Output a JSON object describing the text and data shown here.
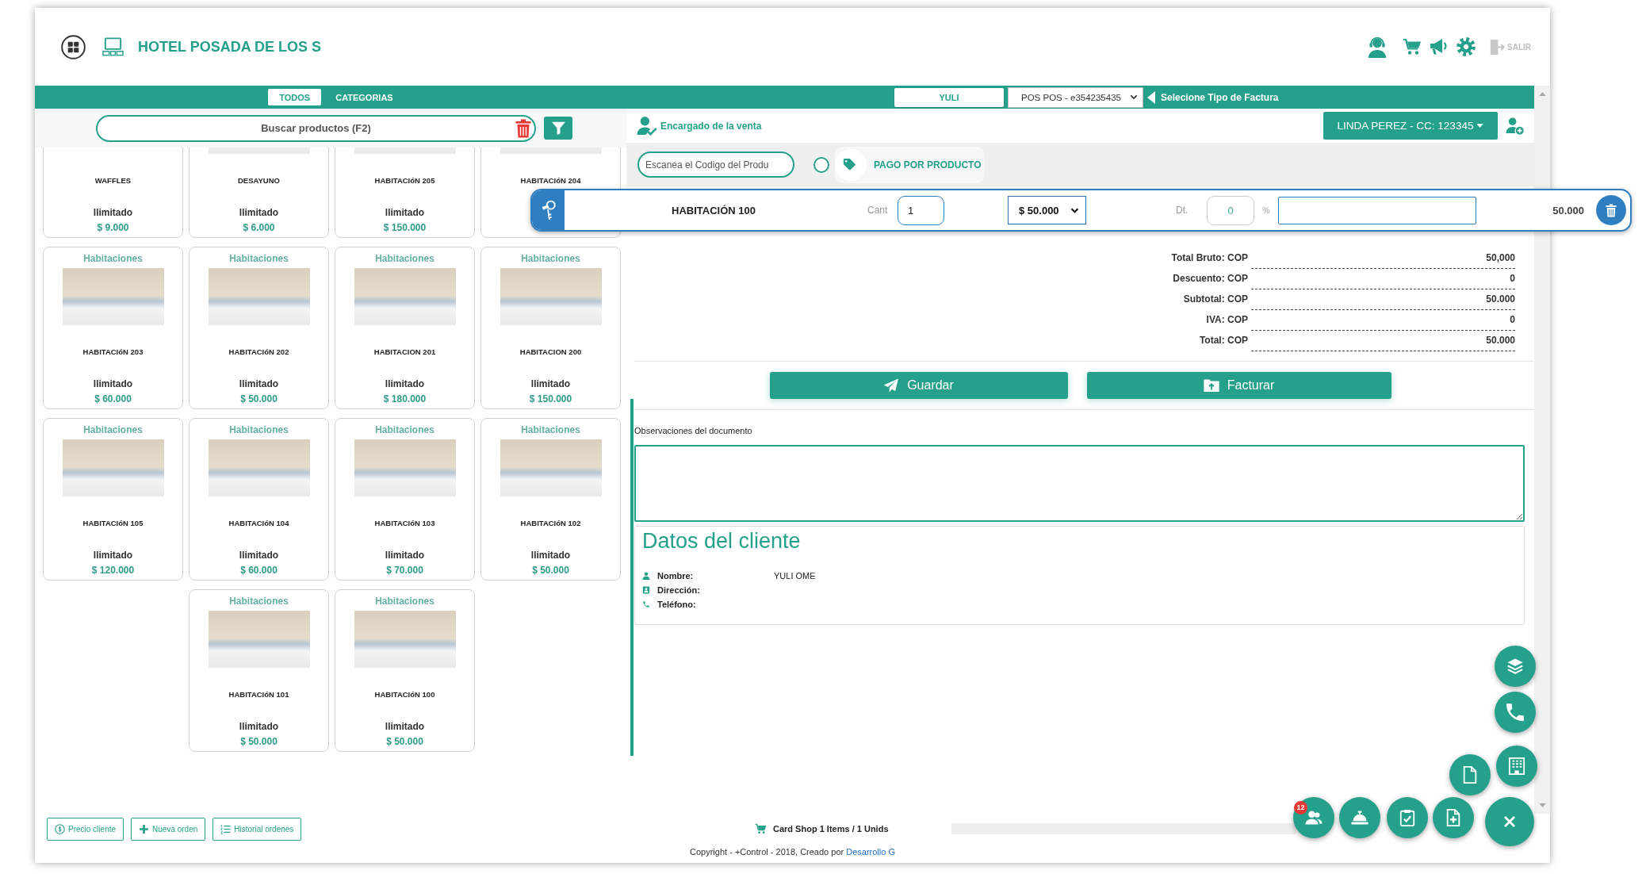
{
  "header": {
    "title": "HOTEL POSADA DE LOS S",
    "logout": "SALIR"
  },
  "toolbar": {
    "tabs": [
      {
        "label": "TODOS",
        "selected": true
      },
      {
        "label": "CATEGORIAS",
        "selected": false
      }
    ],
    "seller": "YULI",
    "pos": "POS POS - e354235435",
    "invoice_hint": "Selecione Tipo de Factura"
  },
  "search": {
    "placeholder": "Buscar productos (F2)"
  },
  "products": [
    {
      "name": "WAFFLES",
      "photo": false,
      "stock": "Ilimitado",
      "price": "$ 9.000"
    },
    {
      "name": "DESAYUNO",
      "photo": true,
      "stock": "Ilimitado",
      "price": "$ 6.000"
    },
    {
      "name": "HABITACIóN 205",
      "photo": true,
      "stock": "Ilimitado",
      "price": "$ 150.000"
    },
    {
      "name": "HABITACIóN 204",
      "photo": true
    },
    {
      "category": "Habitaciones",
      "name": "HABITACIóN 203",
      "photo": true,
      "stock": "Ilimitado",
      "price": "$ 60.000"
    },
    {
      "category": "Habitaciones",
      "name": "HABITACIóN 202",
      "photo": true,
      "stock": "Ilimitado",
      "price": "$ 50.000"
    },
    {
      "category": "Habitaciones",
      "name": "HABITACION 201",
      "photo": true,
      "stock": "Ilimitado",
      "price": "$ 180.000"
    },
    {
      "category": "Habitaciones",
      "name": "HABITACION 200",
      "photo": true,
      "stock": "Ilimitado",
      "price": "$ 150.000"
    },
    {
      "category": "Habitaciones",
      "name": "HABITACIóN 105",
      "photo": true,
      "stock": "Ilimitado",
      "price": "$ 120.000"
    },
    {
      "category": "Habitaciones",
      "name": "HABITACIóN 104",
      "photo": true,
      "stock": "Ilimitado",
      "price": "$ 60.000"
    },
    {
      "category": "Habitaciones",
      "name": "HABITACIóN 103",
      "photo": true,
      "stock": "Ilimitado",
      "price": "$ 70.000"
    },
    {
      "category": "Habitaciones",
      "name": "HABITACIóN 102",
      "photo": true,
      "stock": "Ilimitado",
      "price": "$ 50.000"
    },
    {
      "category": "Habitaciones",
      "name": "HABITACIóN 101",
      "photo": true,
      "stock": "Ilimitado",
      "price": "$ 50.000"
    },
    {
      "category": "Habitaciones",
      "name": "HABITACIóN 100",
      "photo": true,
      "stock": "Ilimitado",
      "price": "$ 50.000"
    }
  ],
  "sale": {
    "seller_label": "Encargado de la venta",
    "customer": "LINDA PEREZ - CC: 123345",
    "scan_placeholder": "Escanea el Codigo del Produ",
    "pay_by_product": {
      "label": "PAGO POR PRODUCTO",
      "checked": false
    }
  },
  "line_item": {
    "name": "HABITACIÓN 100",
    "qty_label": "Cant",
    "qty": "1",
    "price": "$ 50.000",
    "discount_label": "Dt.",
    "discount": "0",
    "percent": "%",
    "total": "50.000"
  },
  "totals": [
    {
      "label": "Total Bruto: COP",
      "value": "50,000"
    },
    {
      "label": "Descuento: COP",
      "value": "0"
    },
    {
      "label": "Subtotal: COP",
      "value": "50.000"
    },
    {
      "label": "IVA: COP",
      "value": "0"
    },
    {
      "label": "Total: COP",
      "value": "50.000"
    }
  ],
  "actions": [
    {
      "kind": "save",
      "label": "Guardar"
    },
    {
      "kind": "invoice",
      "label": "Facturar"
    }
  ],
  "notes": {
    "label": "Observaciones del documento"
  },
  "client": {
    "title": "Datos del cliente",
    "fields": [
      {
        "kind": "name",
        "label": "Nombre:",
        "value": "YULI OME"
      },
      {
        "kind": "address",
        "label": "Dirección:"
      },
      {
        "kind": "phone",
        "label": "Teléfono:"
      }
    ]
  },
  "bottom_buttons": [
    {
      "kind": "price",
      "label": "Precio cliente"
    },
    {
      "kind": "new",
      "label": "Nueva orden"
    },
    {
      "kind": "history",
      "label": "Historial ordenes"
    }
  ],
  "cart": {
    "summary": "Card Shop **1** Items / **1** Unids"
  },
  "quick_actions": [
    {
      "kind": "layers"
    },
    {
      "kind": "phone"
    },
    {
      "kind": "file"
    },
    {
      "kind": "building"
    },
    {
      "kind": "users",
      "badge": "12"
    },
    {
      "kind": "bell"
    },
    {
      "kind": "clipboard"
    },
    {
      "kind": "add-file"
    },
    {
      "kind": "close"
    }
  ],
  "footer": {
    "copyright": "Copyright - +Control - 2018, Creado por",
    "link": "Desarrollo G"
  }
}
